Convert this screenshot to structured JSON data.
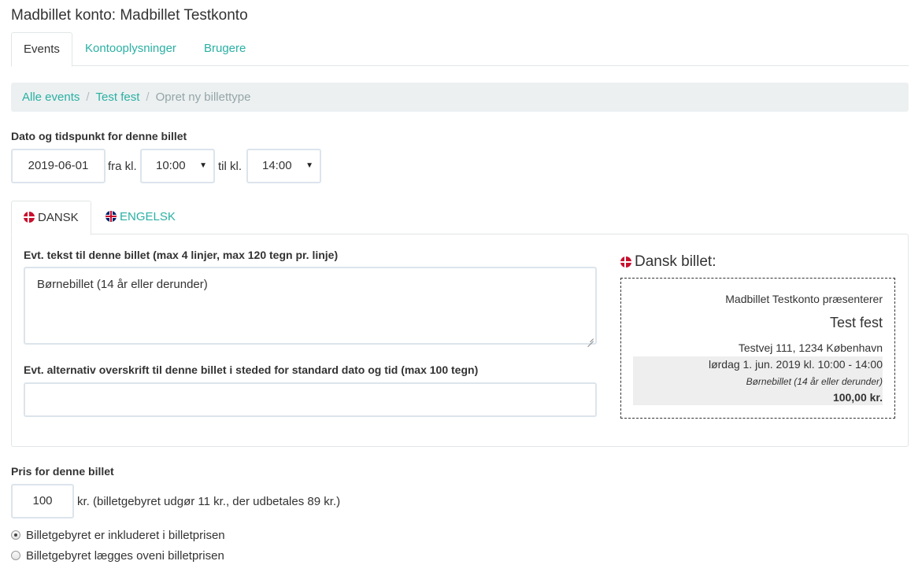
{
  "page": {
    "title": "Madbillet konto: Madbillet Testkonto"
  },
  "top_tabs": [
    {
      "label": "Events",
      "active": true
    },
    {
      "label": "Kontooplysninger",
      "active": false
    },
    {
      "label": "Brugere",
      "active": false
    }
  ],
  "breadcrumb": {
    "items": [
      "Alle events",
      "Test fest"
    ],
    "current": "Opret ny billettype",
    "separator": "/"
  },
  "date_time": {
    "label": "Dato og tidspunkt for denne billet",
    "date": "2019-06-01",
    "from_text": "fra kl.",
    "from_value": "10:00",
    "to_text": "til kl.",
    "to_value": "14:00"
  },
  "language_tabs": [
    {
      "label": "DANSK",
      "icon": "danish-flag-icon",
      "active": true
    },
    {
      "label": "ENGELSK",
      "icon": "uk-flag-icon",
      "active": false
    }
  ],
  "danish_panel": {
    "text_label": "Evt. tekst til denne billet (max 4 linjer, max 120 tegn pr. linje)",
    "text_value": "Børnebillet (14 år eller derunder)",
    "alt_heading_label": "Evt. alternativ overskrift til denne billet i steded for standard dato og tid (max 100 tegn)",
    "alt_heading_value": ""
  },
  "ticket_preview": {
    "title": "Dansk billet:",
    "presenter": "Madbillet Testkonto præsenterer",
    "event_name": "Test fest",
    "address": "Testvej 111, 1234 København",
    "datetime": "lørdag 1. jun. 2019 kl. 10:00 - 14:00",
    "ticket_text": "Børnebillet (14 år eller derunder)",
    "price": "100,00 kr."
  },
  "price": {
    "label": "Pris for denne billet",
    "value": "100",
    "info": "kr. (billetgebyret udgør 11 kr., der udbetales 89 kr.)"
  },
  "fee_options": [
    {
      "label": "Billetgebyret er inkluderet i billetprisen",
      "checked": true
    },
    {
      "label": "Billetgebyret lægges oveni billetprisen",
      "checked": false
    }
  ],
  "colors": {
    "accent": "#2ab0a3",
    "breadcrumb_bg": "#ecf0f1",
    "input_border": "#dce4ec"
  }
}
